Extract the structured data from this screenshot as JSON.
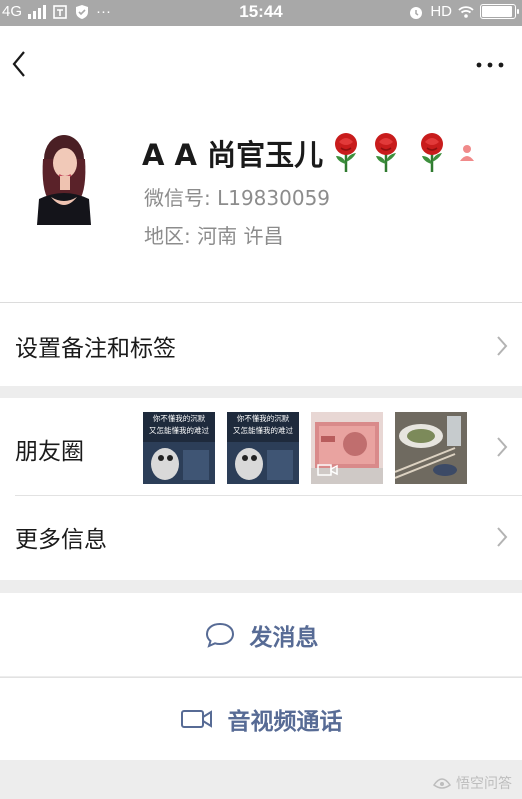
{
  "status_bar": {
    "network": "4G",
    "time": "15:44",
    "hd": "HD",
    "more_dots": "···",
    "battery_level": 0.95
  },
  "profile": {
    "name": "A A 尚官玉儿",
    "wechat_id": "微信号:  L19830059",
    "region": "地区:  河南  许昌"
  },
  "rows": {
    "remark_label": "设置备注和标签",
    "moments_label": "朋友圈",
    "more_info_label": "更多信息"
  },
  "moments": {
    "meme_caption_line1": "你不懂我的沉默",
    "meme_caption_line2": "又怎能懂我的难过"
  },
  "actions": {
    "send_message": "发消息",
    "video_call": "音视频通话"
  },
  "watermark": "悟空问答",
  "colors": {
    "action_text": "#576b95",
    "secondary_text": "#8c8c8c",
    "background": "#ededed"
  }
}
